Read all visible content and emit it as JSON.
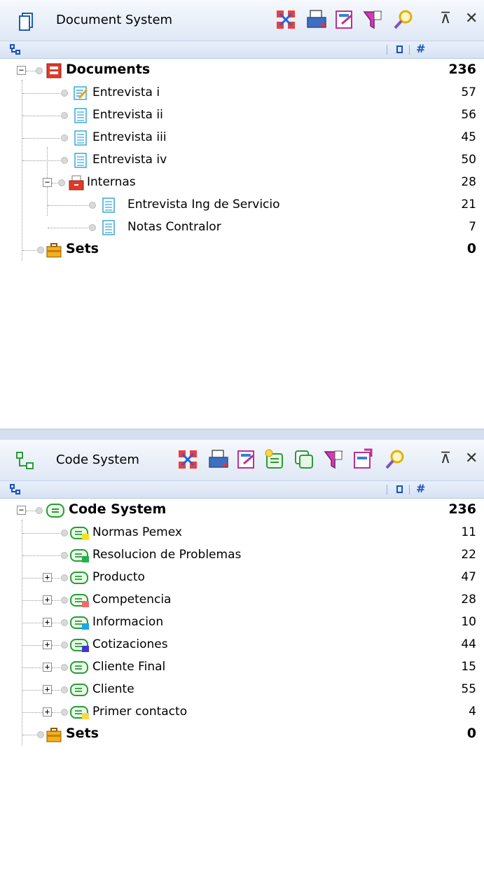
{
  "doc_panel": {
    "title": "Document System",
    "close_glyph": "✕",
    "min_glyph": "⊼",
    "hash": "#",
    "tree": [
      {
        "label": "Documents",
        "count": "236",
        "bold": true,
        "level": 0,
        "icon": "documents-root-icon",
        "expander": "−"
      },
      {
        "label": "Entrevista i",
        "count": "57",
        "level": 1,
        "icon": "memo-document-icon"
      },
      {
        "label": "Entrevista ii",
        "count": "56",
        "level": 1,
        "icon": "text-document-icon"
      },
      {
        "label": "Entrevista iii",
        "count": "45",
        "level": 1,
        "icon": "text-document-icon"
      },
      {
        "label": "Entrevista iv",
        "count": "50",
        "level": 1,
        "icon": "text-document-icon"
      },
      {
        "label": "Internas",
        "count": "28",
        "level": 1,
        "icon": "document-group-icon",
        "expander": "−"
      },
      {
        "label": "Entrevista Ing de Servicio",
        "count": "21",
        "level": 2,
        "icon": "text-document-icon"
      },
      {
        "label": "Notas Contralor",
        "count": "7",
        "level": 2,
        "icon": "text-document-icon"
      },
      {
        "label": "Sets",
        "count": "0",
        "bold": true,
        "level": 0,
        "icon": "sets-icon"
      }
    ]
  },
  "code_panel": {
    "title": "Code System",
    "close_glyph": "✕",
    "min_glyph": "⊼",
    "hash": "#",
    "tree": [
      {
        "label": "Code System",
        "count": "236",
        "bold": true,
        "level": 0,
        "icon": "code-system-root-icon",
        "expander": "−"
      },
      {
        "label": "Normas Pemex",
        "count": "11",
        "level": 1,
        "icon": "code-icon",
        "color": "#f4e21a"
      },
      {
        "label": "Resolucion de Problemas",
        "count": "22",
        "level": 1,
        "icon": "code-icon",
        "color": "#22b14c"
      },
      {
        "label": "Producto",
        "count": "47",
        "level": 1,
        "icon": "code-icon",
        "expander": "+"
      },
      {
        "label": "Competencia",
        "count": "28",
        "level": 1,
        "icon": "code-icon",
        "color": "#f26b6b",
        "expander": "+"
      },
      {
        "label": "Informacion",
        "count": "10",
        "level": 1,
        "icon": "code-icon",
        "color": "#19a7e8",
        "expander": "+"
      },
      {
        "label": "Cotizaciones",
        "count": "44",
        "level": 1,
        "icon": "code-icon",
        "color": "#4433d6",
        "expander": "+"
      },
      {
        "label": "Cliente Final",
        "count": "15",
        "level": 1,
        "icon": "code-icon",
        "expander": "+"
      },
      {
        "label": "Cliente",
        "count": "55",
        "level": 1,
        "icon": "code-icon",
        "expander": "+"
      },
      {
        "label": "Primer contacto",
        "count": "4",
        "level": 1,
        "icon": "code-icon",
        "color": "#f7d84a",
        "expander": "+"
      },
      {
        "label": "Sets",
        "count": "0",
        "bold": true,
        "level": 0,
        "icon": "sets-icon"
      }
    ]
  }
}
